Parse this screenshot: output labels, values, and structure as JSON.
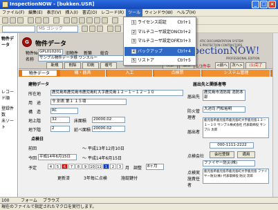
{
  "window": {
    "title": "InspectionNOW - [bukken.USR]"
  },
  "menubar": [
    "ファイル(F)",
    "編集(E)",
    "表示(V)",
    "挿入(I)",
    "書式(O)",
    "レコード(R)",
    "ツール",
    "ウィンドウ(W)",
    "ヘルプ(H)"
  ],
  "toolbar": {
    "font_combo": "MS ゴシック"
  },
  "left_panel": {
    "title": "物件データ",
    "items": [
      "レコード順",
      "登録件数",
      "未ソート"
    ],
    "zoom": "100"
  },
  "form": {
    "header_title": "物件データ",
    "logo": "G",
    "bukken_no_label": "物件No",
    "bukken_no": "GPL010201",
    "check_old": "旧物件",
    "check_new": "新築",
    "check_combined": "総合",
    "name_label": "名称",
    "name": "サンプル物件データ様 ワンスルー",
    "buttons": {
      "new": "新規",
      "delete": "削除",
      "print": "印刷",
      "copy": "複写",
      "search": "検索",
      "release": "解除",
      "prev": "<前へ",
      "next": "次へ>",
      "done": "(1)完了"
    },
    "record_count": "1/3件中",
    "brand_lines": [
      "ATIC DOCUMENTATION SYSTEM",
      "E PROTECTION CONTRACTORS"
    ],
    "brand_big": "pectionNOW!",
    "brand_edition": "PROFESSIONAL EDITION",
    "tabs": [
      "物件データ",
      "機・器具",
      "入工",
      "点検票",
      "システム管理"
    ],
    "section_building": "建物データ",
    "fields": [
      {
        "label": "所在地",
        "value": "鹿児島県鹿児島市鹿児島町大字鹿児島１２－１－１２－１０"
      },
      {
        "label": "用　途",
        "value": "令  別表  第１  １５項"
      },
      {
        "label": "構　造",
        "value": "RC"
      },
      {
        "label": "地上階",
        "value": "32"
      },
      {
        "label": "地下階",
        "value": "2"
      }
    ],
    "floor_area_label": "床面積",
    "floor_area": "20000.02",
    "total_area_label": "延べ面積",
    "total_area": "20000.02",
    "section_inspection": "点検日",
    "prev_label": "前回",
    "prev_to": "平成13年12月10日",
    "this_label": "今回",
    "this_from": "平成14年6月15日",
    "this_to": "平成14年6月15日",
    "plan_label": "予定",
    "cal_nums": [
      "4",
      "5",
      "6",
      "7",
      "8",
      "9",
      "10",
      "11",
      "1",
      "2",
      "3"
    ],
    "plan_suffix": "月",
    "adjust_label": "調整",
    "adjust_value": "8ヶ月",
    "check_update": "更新済",
    "check_3yr": "3年毎に点検",
    "check_lock": "施錠鍵付",
    "section_report": "届出先と関係者等",
    "report_dest_label": "届出先",
    "report_dest": "鹿児島市消防局 消防本部",
    "manager_label": "防火管理者",
    "manager": "大池司  門松裕明",
    "notifier_label": "届出者",
    "notifier": "鹿児島県鹿児島市鹿児島町大字鹿児島１２－１－１０ サンプル株式会社 代表取締役  サンプル 太郎",
    "phone": "000-1111-2222",
    "contractor_label": "点検会社",
    "contractor_btn": "会社登録",
    "apply_btn": "適用",
    "contractor_name": "ファイヤー防災(株)",
    "inspector_label": "点検実施責任者",
    "inspector": "鹿児島県鹿児島市鹿児島町大字鹿児島 ファイヤー防災(株) 代表取締役  防災 次郎"
  },
  "menu": {
    "items": [
      {
        "num": "1",
        "label": "ライセンス認証",
        "shortcut": "Ctrl+1"
      },
      {
        "num": "2",
        "label": "マルチユーザ設定ON",
        "shortcut": "Ctrl+2"
      },
      {
        "num": "3",
        "label": "マルチユーザ設定OFF",
        "shortcut": "Ctrl+3"
      },
      {
        "num": "4",
        "label": "バックアップ",
        "shortcut": "Ctrl+4"
      },
      {
        "num": "5",
        "label": "リストア",
        "shortcut": "Ctrl+5"
      }
    ]
  },
  "status": {
    "view": "フォーム",
    "record_nav": "ブラウズ",
    "text": "現在のファイルで指定されたマクロを実行します。"
  }
}
